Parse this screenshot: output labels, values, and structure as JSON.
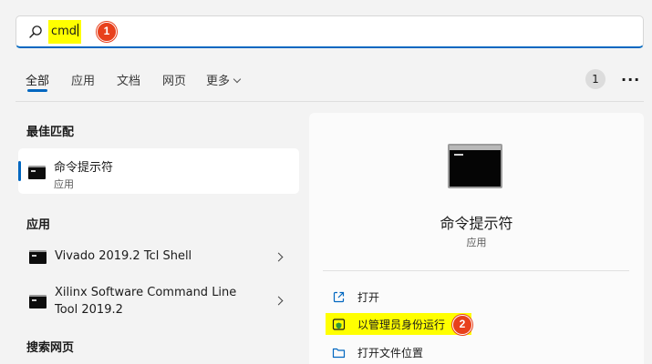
{
  "search": {
    "value": "cmd",
    "callout": "1"
  },
  "tabs": [
    {
      "label": "全部"
    },
    {
      "label": "应用"
    },
    {
      "label": "文档"
    },
    {
      "label": "网页"
    },
    {
      "label": "更多"
    }
  ],
  "header": {
    "count": "1",
    "more": "···"
  },
  "best_match": {
    "heading": "最佳匹配",
    "title": "命令提示符",
    "subtitle": "应用"
  },
  "apps": {
    "heading": "应用",
    "items": [
      {
        "name": "Vivado 2019.2 Tcl Shell"
      },
      {
        "name_line1": "Xilinx Software Command Line",
        "name_line2": "Tool 2019.2"
      }
    ]
  },
  "web": {
    "heading": "搜索网页"
  },
  "preview": {
    "title": "命令提示符",
    "subtitle": "应用",
    "actions": [
      {
        "label": "打开",
        "icon": "open-external-icon"
      },
      {
        "label": "以管理员身份运行",
        "icon": "shield-admin-icon",
        "callout": "2"
      },
      {
        "label": "打开文件位置",
        "icon": "folder-icon"
      }
    ]
  },
  "colors": {
    "accent": "#0067c0",
    "highlight": "#ffff00",
    "callout": "#e8401c"
  }
}
